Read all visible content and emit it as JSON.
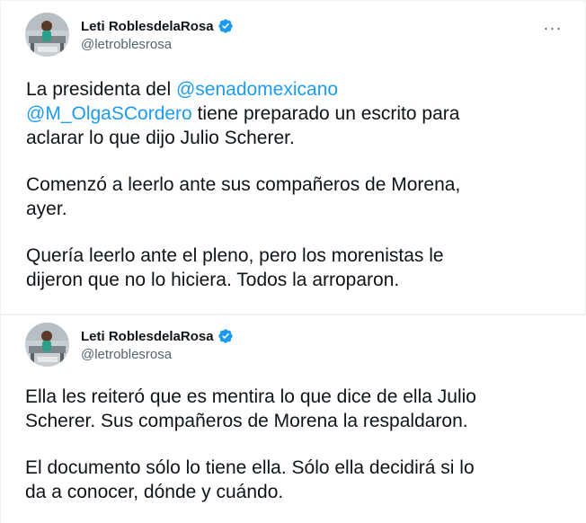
{
  "tweets": [
    {
      "author": {
        "display_name": "Leti RoblesdelaRosa",
        "handle": "@letroblesrosa",
        "verified": true,
        "avatar_icon": "profile-photo"
      },
      "more_icon": "···",
      "paragraphs": [
        {
          "lines": [
            [
              {
                "text": "La presidenta del "
              },
              {
                "text": "@senadomexicano",
                "mention": true
              }
            ],
            [
              {
                "text": "@M_OlgaSCordero",
                "mention": true
              },
              {
                "text": " tiene preparado un escrito para"
              }
            ],
            [
              {
                "text": "aclarar lo que dijo Julio Scherer."
              }
            ]
          ]
        },
        {
          "lines": [
            [
              {
                "text": "Comenzó a leerlo ante sus compañeros de Morena,"
              }
            ],
            [
              {
                "text": "ayer."
              }
            ]
          ]
        },
        {
          "lines": [
            [
              {
                "text": "Quería leerlo ante el pleno, pero los morenistas le"
              }
            ],
            [
              {
                "text": "dijeron que no lo hiciera. Todos la arroparon."
              }
            ]
          ]
        }
      ]
    },
    {
      "author": {
        "display_name": "Leti RoblesdelaRosa",
        "handle": "@letroblesrosa",
        "verified": true,
        "avatar_icon": "profile-photo"
      },
      "paragraphs": [
        {
          "lines": [
            [
              {
                "text": "Ella les reiteró que es mentira lo que dice de ella Julio"
              }
            ],
            [
              {
                "text": "Scherer. Sus compañeros de Morena la respaldaron."
              }
            ]
          ]
        },
        {
          "lines": [
            [
              {
                "text": "El documento sólo lo tiene ella. Sólo ella decidirá si lo"
              }
            ],
            [
              {
                "text": "da a conocer, dónde y cuándo."
              }
            ]
          ]
        }
      ]
    }
  ],
  "colors": {
    "text": "#0f1419",
    "secondary": "#536471",
    "mention": "#1d9bf0",
    "verified": "#1d9bf0",
    "border": "#eff3f4"
  }
}
